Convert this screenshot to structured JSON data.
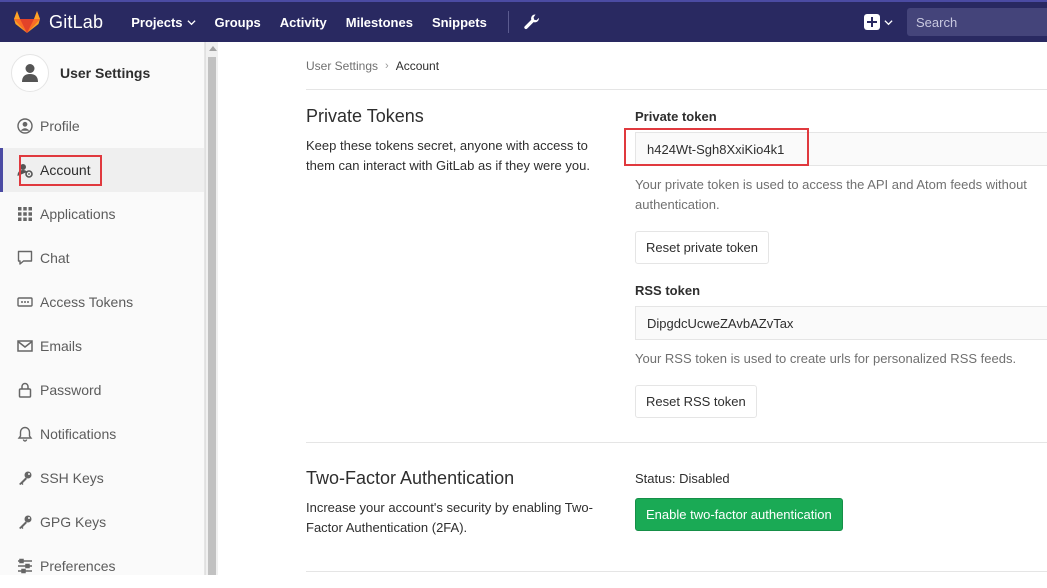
{
  "navbar": {
    "brand": "GitLab",
    "links": [
      "Projects",
      "Groups",
      "Activity",
      "Milestones",
      "Snippets"
    ],
    "search_placeholder": "Search",
    "colors": {
      "background": "#292961",
      "accent": "#4b4ba3"
    }
  },
  "sidebar": {
    "title": "User Settings",
    "items": [
      {
        "label": "Profile",
        "icon": "profile-icon"
      },
      {
        "label": "Account",
        "icon": "account-gear-icon"
      },
      {
        "label": "Applications",
        "icon": "applications-grid-icon"
      },
      {
        "label": "Chat",
        "icon": "chat-icon"
      },
      {
        "label": "Access Tokens",
        "icon": "access-tokens-icon"
      },
      {
        "label": "Emails",
        "icon": "envelope-icon"
      },
      {
        "label": "Password",
        "icon": "lock-icon"
      },
      {
        "label": "Notifications",
        "icon": "bell-icon"
      },
      {
        "label": "SSH Keys",
        "icon": "key-icon"
      },
      {
        "label": "GPG Keys",
        "icon": "key-icon"
      },
      {
        "label": "Preferences",
        "icon": "sliders-icon"
      }
    ],
    "active_label": "Account"
  },
  "breadcrumb": {
    "parent": "User Settings",
    "current": "Account"
  },
  "private_tokens": {
    "title": "Private Tokens",
    "description": "Keep these tokens secret, anyone with access to them can interact with GitLab as if they were you.",
    "private_token_label": "Private token",
    "private_token_value": "h424Wt-Sgh8XxiKio4k1",
    "private_token_help": "Your private token is used to access the API and Atom feeds without authentication.",
    "reset_private_label": "Reset private token",
    "rss_token_label": "RSS token",
    "rss_token_value": "DipgdcUcweZAvbAZvTax",
    "rss_token_help": "Your RSS token is used to create urls for personalized RSS feeds.",
    "reset_rss_label": "Reset RSS token"
  },
  "two_factor": {
    "title": "Two-Factor Authentication",
    "description": "Increase your account's security by enabling Two-Factor Authentication (2FA).",
    "status": "Status: Disabled",
    "enable_label": "Enable two-factor authentication",
    "button_color": "#1aaa55"
  },
  "highlight_color": "#e0393e"
}
